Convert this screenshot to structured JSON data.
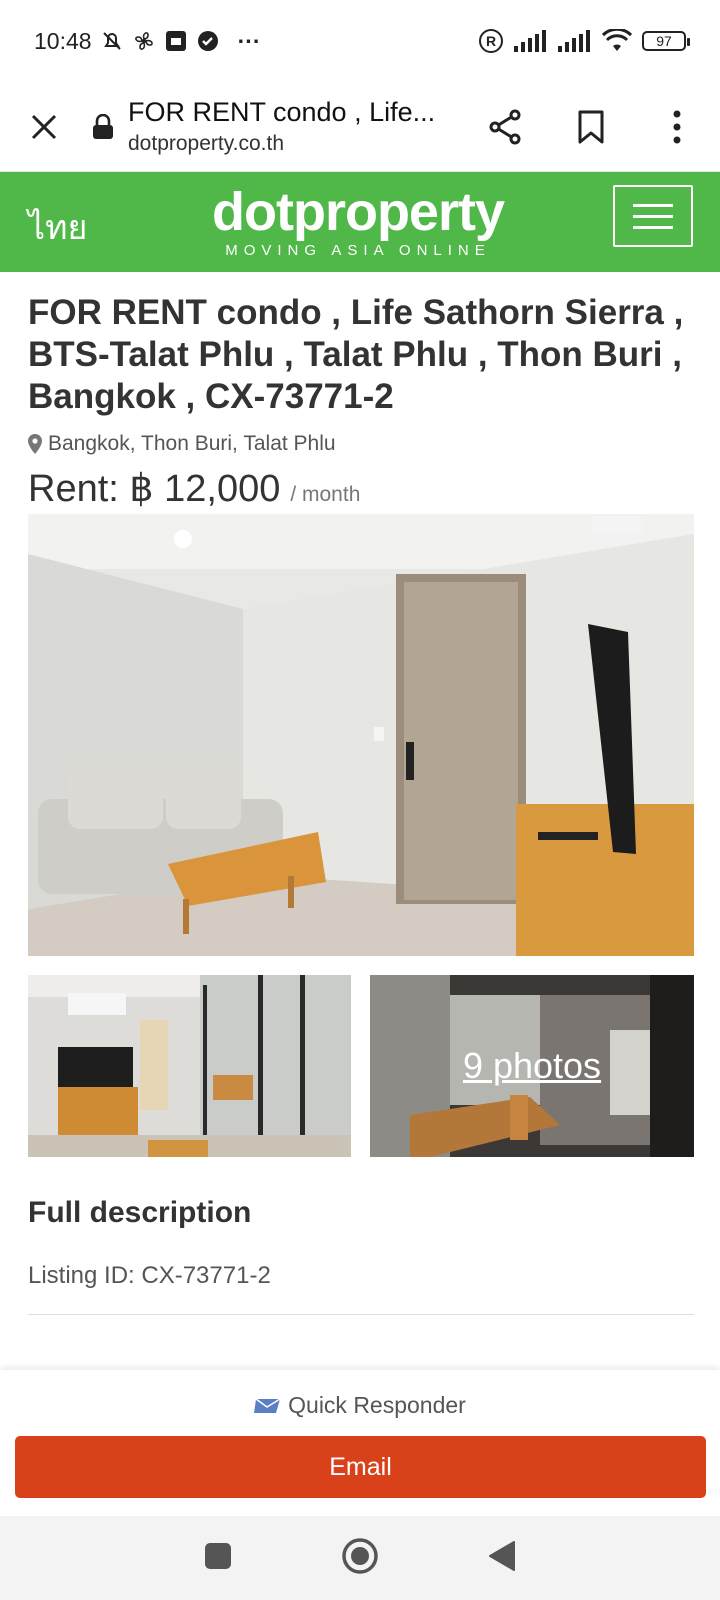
{
  "status_bar": {
    "time": "10:48",
    "extra": "···",
    "battery": "97"
  },
  "browser": {
    "page_title": "FOR RENT condo , Life...",
    "domain": "dotproperty.co.th"
  },
  "site_header": {
    "lang_link": "ไทย",
    "logo_text": "dotproperty",
    "tagline": "MOVING ASIA ONLINE",
    "brand_color": "#4fb848"
  },
  "listing": {
    "title": "FOR RENT condo , Life Sathorn Sierra , BTS-Talat Phlu , Talat Phlu , Thon Buri , Bangkok , CX-73771-2",
    "location": "Bangkok, Thon Buri, Talat Phlu",
    "rent_label": "Rent: ฿ 12,000",
    "rent_period": "/ month",
    "photos_link": "9 photos"
  },
  "description": {
    "heading": "Full description",
    "listing_id": "Listing ID: CX-73771-2"
  },
  "contact": {
    "quick_responder": "Quick Responder",
    "email_button": "Email",
    "accent_color": "#d9411a"
  }
}
